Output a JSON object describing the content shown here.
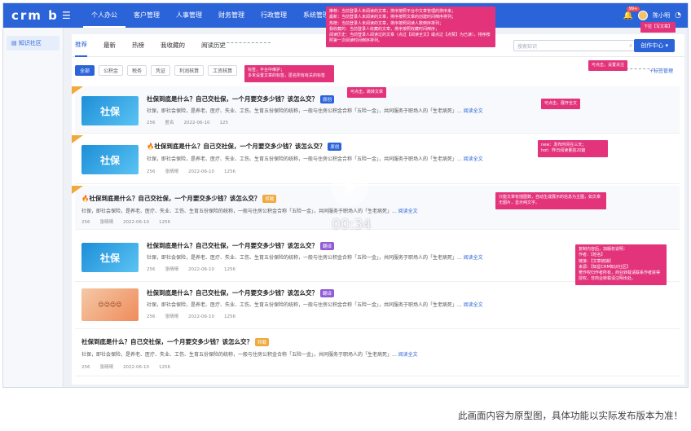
{
  "topbar": {
    "logo": "crm b",
    "nav": [
      "个人办公",
      "客户管理",
      "人事管理",
      "财务管理",
      "行政管理",
      "系统管理"
    ],
    "notification_count": "99+",
    "username": "陈小明"
  },
  "sidebar": {
    "items": [
      "知识社区"
    ]
  },
  "tabs": [
    "推荐",
    "最新",
    "热榜",
    "我收藏的",
    "阅读历史"
  ],
  "search": {
    "placeholder": "搜索知识"
  },
  "create_button": "创作中心",
  "filters": [
    "全部",
    "公积金",
    "税务",
    "凭证",
    "利润核算",
    "工资核算"
  ],
  "tag_manage": "标签管理",
  "articles": [
    {
      "title": "社保到底是什么？自己交社保，一个月要交多少钱？该怎么交？",
      "tag": "原创",
      "excerpt": "社保，即社会保险，是养老、医疗、失业、工伤、生育五份保险的统称，一般与住房公积金合称「五险一金」，共同服务于职场人的「生老病死」...",
      "more": "阅读全文",
      "views": "256",
      "author": "匿名",
      "date": "2022-06-10",
      "likes": "125"
    },
    {
      "title": "社保到底是什么？自己交社保，一个月要交多少钱？该怎么交？",
      "tag": "原创",
      "excerpt": "社保，即社会保险，是养老、医疗、失业、工伤、生育五份保险的统称，一般与住房公积金合称「五险一金」，共同服务于职场人的「生老病死」...",
      "more": "阅读全文",
      "views": "256",
      "author": "张晴晴",
      "date": "2022-06-10",
      "likes": "1256"
    },
    {
      "title": "社保到底是什么？自己交社保，一个月要交多少钱？该怎么交？",
      "tag": "转载",
      "excerpt": "社保，即社会保险，是养老、医疗、失业、工伤、生育五份保险的统称，一般与住房公积金合称「五险一金」，共同服务于职场人的「生老病死」...",
      "more": "阅读全文",
      "views": "256",
      "author": "张晴晴",
      "date": "2022-06-10",
      "likes": "1256"
    },
    {
      "title": "社保到底是什么？自己交社保，一个月要交多少钱？该怎么交？",
      "tag": "翻译",
      "excerpt": "社保，即社会保险，是养老、医疗、失业、工伤、生育五份保险的统称，一般与住房公积金合称「五险一金」，共同服务于职场人的「生老病死」...",
      "more": "阅读全文",
      "views": "256",
      "author": "张晴晴",
      "date": "2022-06-10",
      "likes": "1256"
    },
    {
      "title": "社保到底是什么？自己交社保，一个月要交多少钱？该怎么交？",
      "tag": "翻译",
      "excerpt": "社保，即社会保险，是养老、医疗、失业、工伤、生育五份保险的统称，一般与住房公积金合称「五险一金」，共同服务于职场人的「生老病死」...",
      "more": "阅读全文",
      "views": "256",
      "author": "张晴晴",
      "date": "2022-06-10",
      "likes": "1256"
    },
    {
      "title": "社保到底是什么？自己交社保，一个月要交多少钱？该怎么交？",
      "tag": "转载",
      "excerpt": "社保，即社会保险，是养老、医疗、失业、工伤、生育五份保险的统称，一般与住房公积金合称「五险一金」，共同服务于职场人的「生老病死」...",
      "more": "阅读全文",
      "views": "256",
      "author": "张晴晴",
      "date": "2022-06-10",
      "likes": "1256"
    }
  ],
  "thumb_label": "社保",
  "annotations": {
    "top": "推荐：当前登录人未阅读的文章，排序按照平台中文章管理的排序来；\n最新：当前登录人未阅读的文章，排序按照文章的创建时间倒序排列；\n热榜：当前登录人未阅读的文章，排序按照阅读人数倒序排列；\n我收藏的：当前登录人收藏的文章，排序按照收藏时间倒序；\n阅读历史：当前登录人阅读过的文章（点过【阅读全文】或点过【点赞】为已读），排序按照第一次阅读时间倒序排列。",
    "draft": "下拉【写文章】",
    "filter": "标签，平台中维护；\n多末设置文章的标签，匿名所有有关的标签",
    "tagmgr": "可点击，设置关注",
    "click_title": "可点击，跳转文章",
    "click_more": "可点击，展开全文",
    "new_hot": "new：发布时间在三天；\nhot：昨日阅读量前20篇",
    "no_thumb": "只能文章有插图数，自动生成展示的信息为主图，如文章无图片，显示纯文字。",
    "copyright": "复制内容后，加版权说明：\n作者：【姓名】\n链接：【文章链接】\n来源：【知星CRM知识社区】\n著作权归作者所有，商业转载请联系作者获得授权，非商业转载请注明出处。"
  },
  "video": {
    "time": "00:34"
  },
  "footer": {
    "note": "此画面内容为原型图，具体功能以实际发布版本为准！"
  }
}
